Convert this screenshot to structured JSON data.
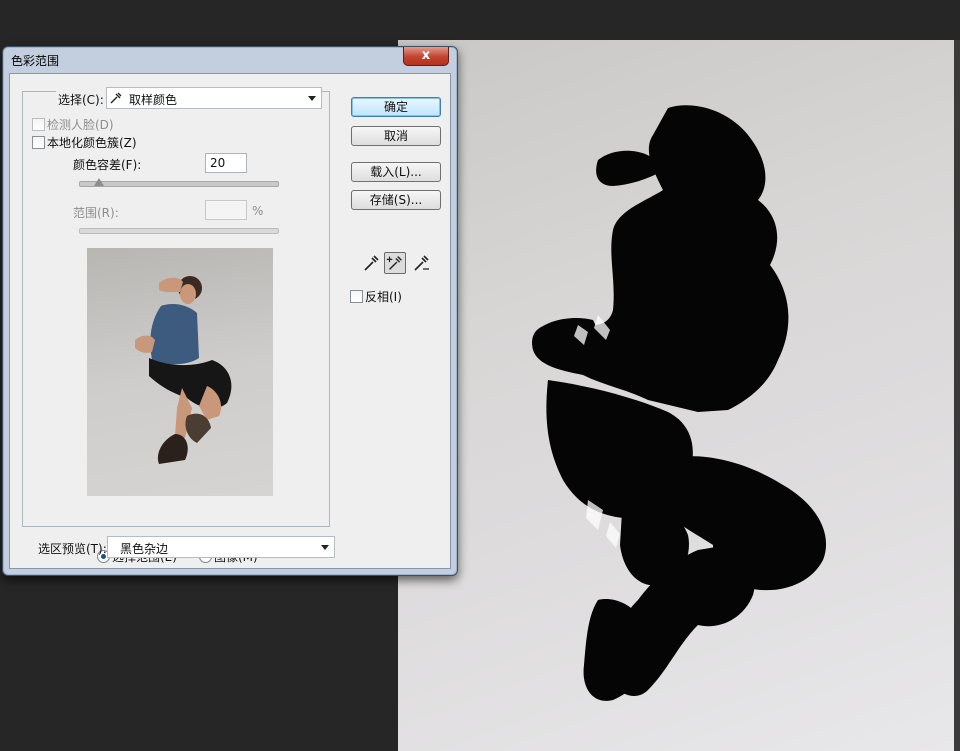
{
  "dialog": {
    "title": "色彩范围",
    "close_glyph": "x",
    "select_label": "选择(C):",
    "select_value": "取样颜色",
    "detect_faces_label": "检测人脸(D)",
    "localized_clusters_label": "本地化颜色簇(Z)",
    "fuzziness_label": "颜色容差(F):",
    "fuzziness_value": "20",
    "fuzziness_level": 0.1,
    "range_label": "范围(R):",
    "range_unit": "%",
    "preview_mode_selection_label": "选择范围(E)",
    "preview_mode_image_label": "图像(M)",
    "selection_preview_label": "选区预览(T):",
    "selection_preview_value": "黑色杂边",
    "buttons": {
      "ok": "确定",
      "cancel": "取消",
      "load": "载入(L)...",
      "save": "存储(S)..."
    },
    "invert_label": "反相(I)",
    "eyedroppers": [
      "eyedropper-icon",
      "eyedropper-add-icon",
      "eyedropper-subtract-icon"
    ]
  },
  "colors": {
    "window_frame": "#c3cfde",
    "close_button": "#c2432f",
    "default_button": "#bee6fd",
    "workspace": "#262626"
  }
}
